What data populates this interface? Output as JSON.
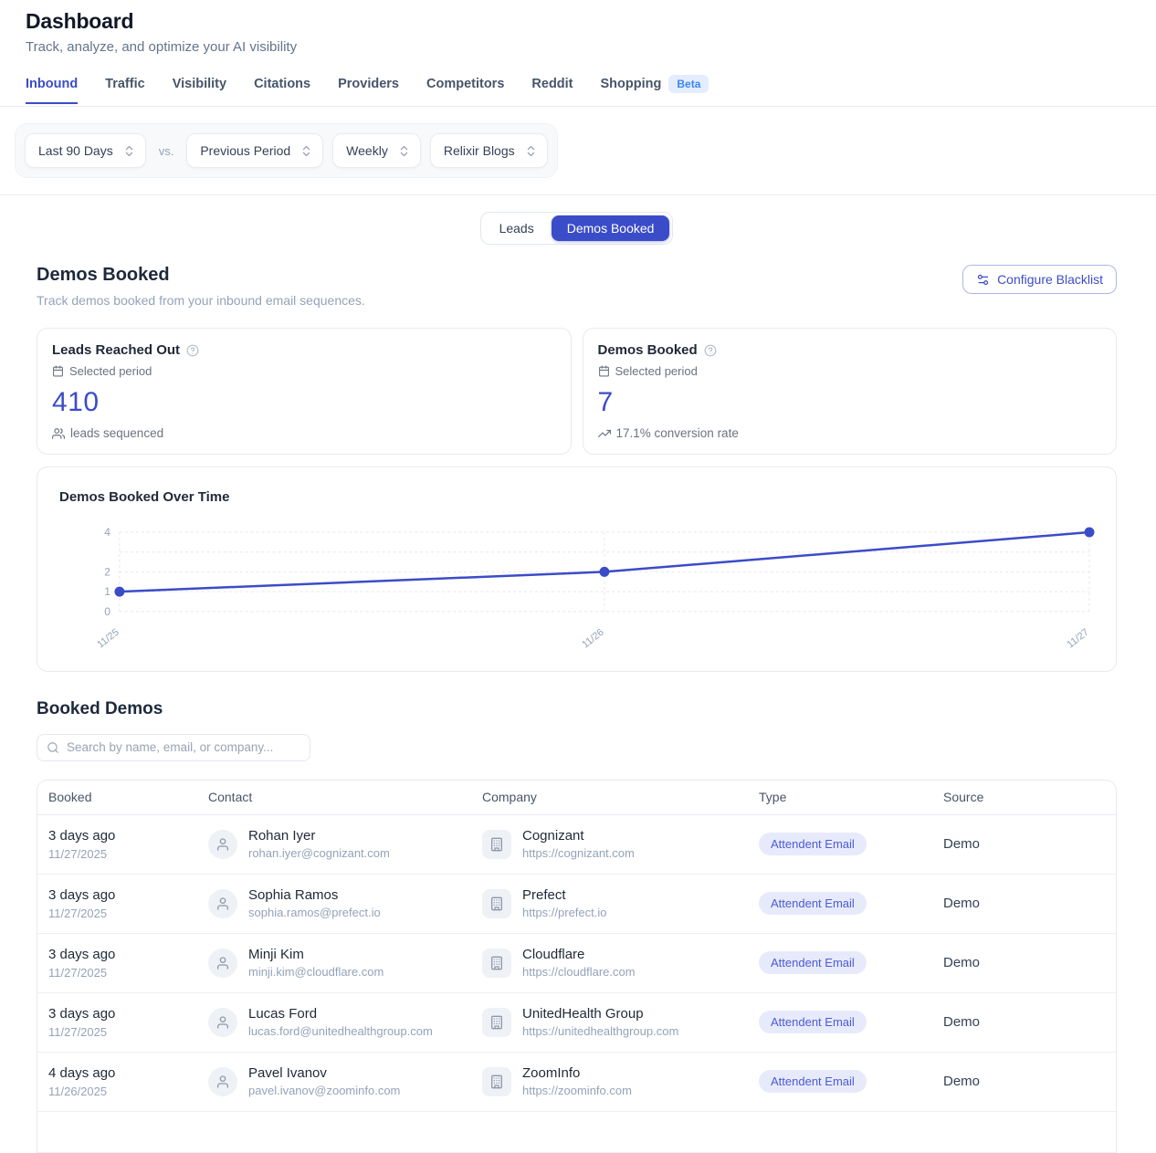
{
  "page": {
    "title": "Dashboard",
    "subtitle": "Track, analyze, and optimize your AI visibility"
  },
  "tabs": [
    {
      "label": "Inbound",
      "active": true,
      "badge": ""
    },
    {
      "label": "Traffic",
      "active": false,
      "badge": ""
    },
    {
      "label": "Visibility",
      "active": false,
      "badge": ""
    },
    {
      "label": "Citations",
      "active": false,
      "badge": ""
    },
    {
      "label": "Providers",
      "active": false,
      "badge": ""
    },
    {
      "label": "Competitors",
      "active": false,
      "badge": ""
    },
    {
      "label": "Reddit",
      "active": false,
      "badge": ""
    },
    {
      "label": "Shopping",
      "active": false,
      "badge": "Beta"
    }
  ],
  "filters": {
    "date_range": "Last 90 Days",
    "vs_label": "vs.",
    "comparison": "Previous Period",
    "granularity": "Weekly",
    "source": "Relixir Blogs"
  },
  "view_toggle": [
    {
      "label": "Leads",
      "active": false
    },
    {
      "label": "Demos Booked",
      "active": true
    }
  ],
  "section": {
    "title": "Demos Booked",
    "subtitle": "Track demos booked from your inbound email sequences.",
    "configure_button": "Configure Blacklist"
  },
  "stats": [
    {
      "title": "Leads Reached Out",
      "period": "Selected period",
      "value": "410",
      "footer": "leads sequenced"
    },
    {
      "title": "Demos Booked",
      "period": "Selected period",
      "value": "7",
      "footer": "17.1% conversion rate"
    }
  ],
  "chart_data": {
    "type": "line",
    "title": "Demos Booked Over Time",
    "x": [
      "11/25",
      "11/26",
      "11/27"
    ],
    "values": [
      1,
      2,
      4
    ],
    "y_ticks": [
      4,
      2,
      1,
      0
    ],
    "ylim": [
      0,
      4
    ],
    "grid": "dashed",
    "legend": "none",
    "line_color": "#3b4cc8"
  },
  "table_section": {
    "title": "Booked Demos",
    "search_placeholder": "Search by name, email, or company...",
    "columns": [
      "Booked",
      "Contact",
      "Company",
      "Type",
      "Source"
    ],
    "rows": [
      {
        "booked_rel": "3 days ago",
        "booked_date": "11/27/2025",
        "contact_name": "Rohan Iyer",
        "contact_email": "rohan.iyer@cognizant.com",
        "company_name": "Cognizant",
        "company_url": "https://cognizant.com",
        "type": "Attendent Email",
        "source": "Demo"
      },
      {
        "booked_rel": "3 days ago",
        "booked_date": "11/27/2025",
        "contact_name": "Sophia Ramos",
        "contact_email": "sophia.ramos@prefect.io",
        "company_name": "Prefect",
        "company_url": "https://prefect.io",
        "type": "Attendent Email",
        "source": "Demo"
      },
      {
        "booked_rel": "3 days ago",
        "booked_date": "11/27/2025",
        "contact_name": "Minji Kim",
        "contact_email": "minji.kim@cloudflare.com",
        "company_name": "Cloudflare",
        "company_url": "https://cloudflare.com",
        "type": "Attendent Email",
        "source": "Demo"
      },
      {
        "booked_rel": "3 days ago",
        "booked_date": "11/27/2025",
        "contact_name": "Lucas Ford",
        "contact_email": "lucas.ford@unitedhealthgroup.com",
        "company_name": "UnitedHealth Group",
        "company_url": "https://unitedhealthgroup.com",
        "type": "Attendent Email",
        "source": "Demo"
      },
      {
        "booked_rel": "4 days ago",
        "booked_date": "11/26/2025",
        "contact_name": "Pavel Ivanov",
        "contact_email": "pavel.ivanov@zoominfo.com",
        "company_name": "ZoomInfo",
        "company_url": "https://zoominfo.com",
        "type": "Attendent Email",
        "source": "Demo"
      }
    ]
  },
  "colors": {
    "primary": "#3b4cc8",
    "badge_bg": "#e7eafb",
    "badge_text": "#4c5bd4",
    "beta_bg": "#e3edfd",
    "beta_text": "#3d84f7",
    "muted_text": "#94a3b8"
  }
}
